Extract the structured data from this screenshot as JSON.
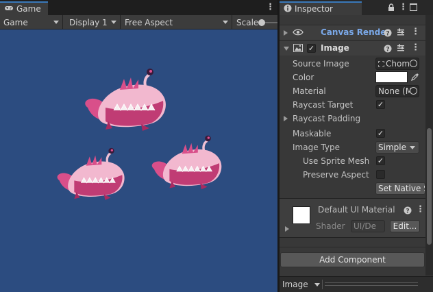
{
  "game": {
    "tab_label": "Game",
    "toolbar": {
      "mode": "Game",
      "display": "Display 1",
      "aspect": "Free Aspect",
      "scale_label": "Scale"
    },
    "background_color": "#2c4c80",
    "creatures": [
      {
        "name": "creature-1"
      },
      {
        "name": "creature-2"
      },
      {
        "name": "creature-3"
      }
    ]
  },
  "inspector": {
    "tab_label": "Inspector",
    "canvas_renderer": {
      "title": "Canvas Rende"
    },
    "image_component": {
      "title": "Image",
      "source_image_label": "Source Image",
      "source_image_value": "Chom",
      "color_label": "Color",
      "color_value": "#ffffff",
      "material_label": "Material",
      "material_value": "None (M",
      "raycast_target_label": "Raycast Target",
      "raycast_target_checked": true,
      "raycast_padding_label": "Raycast Padding",
      "maskable_label": "Maskable",
      "maskable_checked": true,
      "image_type_label": "Image Type",
      "image_type_value": "Simple",
      "use_sprite_mesh_label": "Use Sprite Mesh",
      "use_sprite_mesh_checked": true,
      "preserve_aspect_label": "Preserve Aspect",
      "preserve_aspect_checked": false,
      "set_native_size_label": "Set Native S"
    },
    "material_preview": {
      "title": "Default UI Material",
      "shader_label": "Shader",
      "shader_value": "UI/De",
      "edit_label": "Edit..."
    },
    "add_component_label": "Add Component",
    "footer_dropdown": "Image",
    "accent_color": "#7aa8e8"
  }
}
